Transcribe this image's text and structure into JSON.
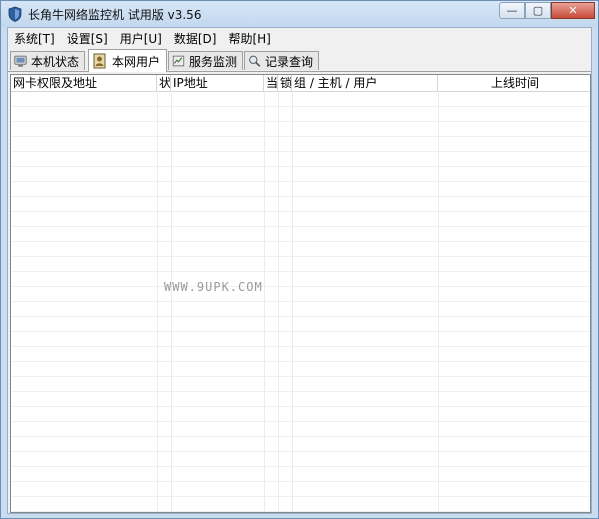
{
  "window": {
    "title": "长角牛网络监控机 试用版 v3.56",
    "controls": {
      "minimize": "—",
      "maximize": "▢",
      "close": "✕"
    }
  },
  "menu": [
    {
      "label": "系统[T]"
    },
    {
      "label": "设置[S]"
    },
    {
      "label": "用户[U]"
    },
    {
      "label": "数据[D]"
    },
    {
      "label": "帮助[H]"
    }
  ],
  "tabs": [
    {
      "label": "本机状态",
      "icon": "monitor-icon",
      "active": false
    },
    {
      "label": "本网用户",
      "icon": "users-icon",
      "active": true
    },
    {
      "label": "服务监测",
      "icon": "service-icon",
      "active": false
    },
    {
      "label": "记录查询",
      "icon": "search-record-icon",
      "active": false
    }
  ],
  "table": {
    "columns": [
      "网卡权限及地址",
      "状",
      "IP地址",
      "当",
      "锁",
      "组 / 主机 / 用户",
      "上线时间"
    ],
    "rows": []
  },
  "watermark": "WWW.9UPK.COM"
}
